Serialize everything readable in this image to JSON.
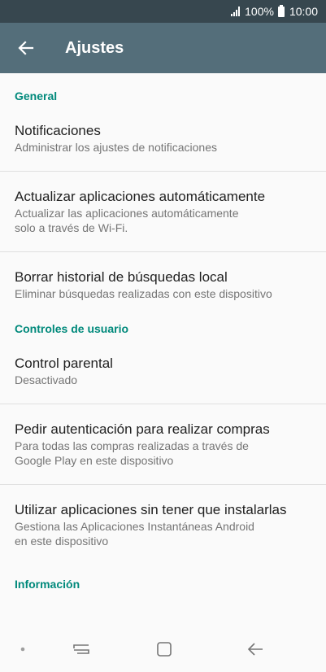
{
  "status": {
    "battery_percent": "100%",
    "time": "10:00"
  },
  "header": {
    "title": "Ajustes"
  },
  "sections": {
    "general": {
      "title": "General",
      "items": [
        {
          "title": "Notificaciones",
          "subtitle": "Administrar los ajustes de notificaciones"
        },
        {
          "title": "Actualizar aplicaciones automáticamente",
          "subtitle_line1": "Actualizar las aplicaciones automáticamente",
          "subtitle_line2": "solo a través de Wi-Fi."
        },
        {
          "title": "Borrar historial de búsquedas local",
          "subtitle": "Eliminar búsquedas realizadas con este dispositivo"
        }
      ]
    },
    "user_controls": {
      "title": "Controles de usuario",
      "items": [
        {
          "title": "Control parental",
          "subtitle": "Desactivado"
        },
        {
          "title": "Pedir autenticación para realizar compras",
          "subtitle_line1": "Para todas las compras realizadas a través de",
          "subtitle_line2": "Google Play en este dispositivo"
        },
        {
          "title": "Utilizar aplicaciones sin tener que instalarlas",
          "subtitle_line1": "Gestiona las Aplicaciones Instantáneas Android",
          "subtitle_line2": "en este dispositivo"
        }
      ]
    },
    "info": {
      "title": "Información"
    }
  },
  "icons": {
    "back": "arrow-left-icon",
    "nav_recent": "recent-apps-icon",
    "nav_home": "home-icon",
    "nav_back": "nav-back-icon"
  },
  "colors": {
    "status_bar": "#37474f",
    "app_bar": "#546e7a",
    "accent": "#00897b",
    "background": "#fafafa"
  }
}
